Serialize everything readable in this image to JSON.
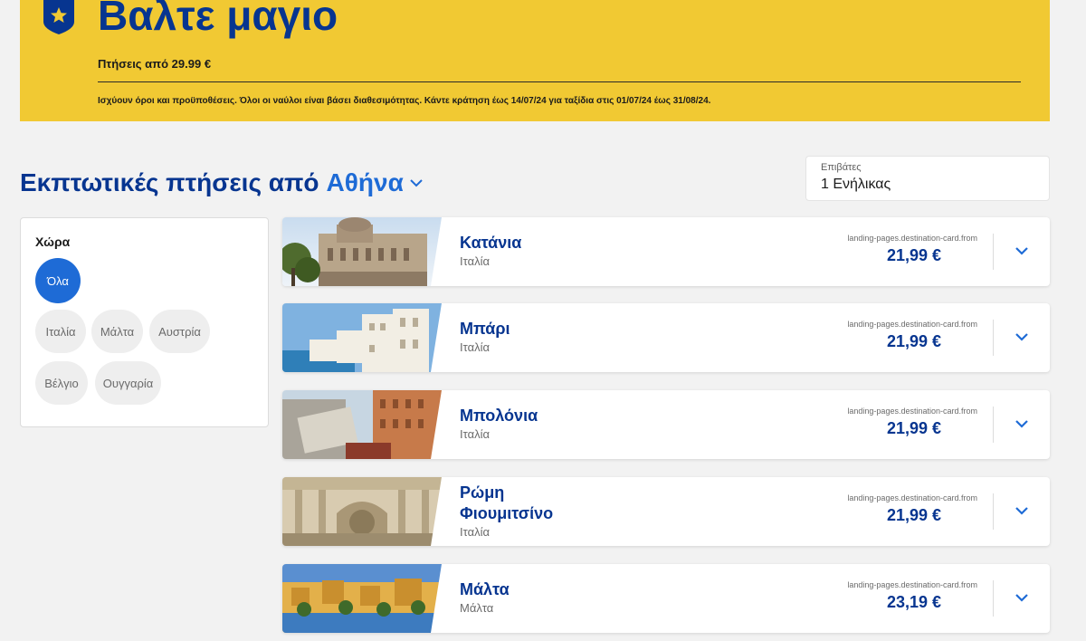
{
  "banner": {
    "title": "Βαλτε μαγιο",
    "subtitle": "Πτήσεις από 29.99 €",
    "terms": "Ισχύουν όροι και προϋποθέσεις. Όλοι οι ναύλοι είναι βάσει διαθεσιμότητας. Κάντε κράτηση έως 14/07/24 για ταξίδια στις 01/07/24 έως 31/08/24."
  },
  "heading": {
    "prefix": "Εκπτωτικές πτήσεις από",
    "city": "Αθήνα"
  },
  "passengers": {
    "label": "Επιβάτες",
    "value": "1 Ενήλικας"
  },
  "filter": {
    "title": "Χώρα",
    "chips": [
      {
        "label": "Όλα",
        "active": true
      },
      {
        "label": "Ιταλία",
        "active": false
      },
      {
        "label": "Μάλτα",
        "active": false
      },
      {
        "label": "Αυστρία",
        "active": false
      },
      {
        "label": "Βέλγιο",
        "active": false
      },
      {
        "label": "Ουγγαρία",
        "active": false
      }
    ]
  },
  "destinations": [
    {
      "city_line1": "Κατάνια",
      "city_line2": "",
      "country": "Ιταλία",
      "from_label": "landing-pages.destination-card.from",
      "price": "21,99 €"
    },
    {
      "city_line1": "Μπάρι",
      "city_line2": "",
      "country": "Ιταλία",
      "from_label": "landing-pages.destination-card.from",
      "price": "21,99 €"
    },
    {
      "city_line1": "Μπολόνια",
      "city_line2": "",
      "country": "Ιταλία",
      "from_label": "landing-pages.destination-card.from",
      "price": "21,99 €"
    },
    {
      "city_line1": "Ρώμη",
      "city_line2": "Φιουμιτσίνο",
      "country": "Ιταλία",
      "from_label": "landing-pages.destination-card.from",
      "price": "21,99 €"
    },
    {
      "city_line1": "Μάλτα",
      "city_line2": "",
      "country": "Μάλτα",
      "from_label": "landing-pages.destination-card.from",
      "price": "23,19 €"
    }
  ],
  "colors": {
    "brand_yellow": "#f1c933",
    "brand_navy": "#073590",
    "accent_blue": "#1e6bd6"
  },
  "icons": {
    "badge": "star-shield-icon",
    "dropdown": "chevron-down-icon",
    "expand": "chevron-down-icon"
  }
}
